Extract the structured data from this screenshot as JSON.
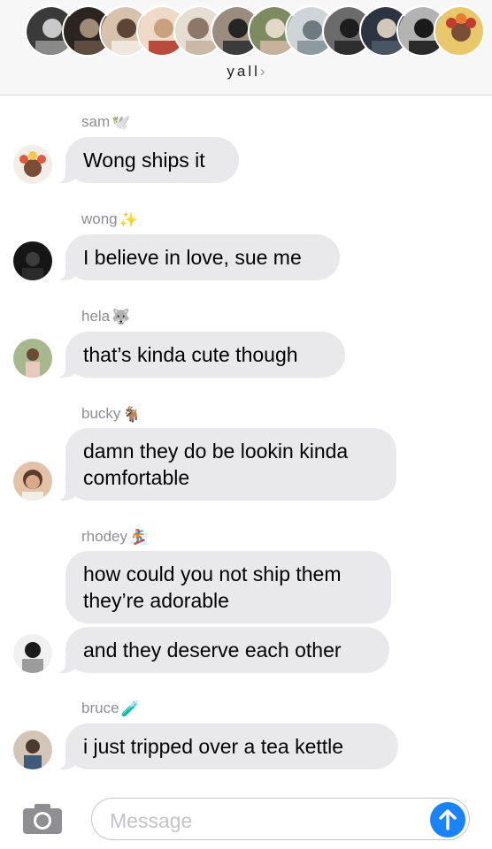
{
  "header": {
    "group_name": "yall",
    "avatars": [
      {
        "name": "member-1",
        "colors": [
          "#3a3a3a",
          "#c9c9c9"
        ]
      },
      {
        "name": "member-2",
        "colors": [
          "#2b2420",
          "#a08a78"
        ]
      },
      {
        "name": "member-3",
        "colors": [
          "#5a4536",
          "#d6c2ad"
        ]
      },
      {
        "name": "member-4",
        "colors": [
          "#b94a3c",
          "#efd9c7"
        ]
      },
      {
        "name": "member-5",
        "colors": [
          "#8e7766",
          "#e6ddd3"
        ]
      },
      {
        "name": "member-6",
        "colors": [
          "#252525",
          "#9b8c80"
        ]
      },
      {
        "name": "member-7",
        "colors": [
          "#7c8c60",
          "#e2d8c6"
        ]
      },
      {
        "name": "member-8",
        "colors": [
          "#6e7a80",
          "#cfd4d6"
        ]
      },
      {
        "name": "member-9",
        "colors": [
          "#1d1d1d",
          "#6b6b6b"
        ]
      },
      {
        "name": "member-10",
        "colors": [
          "#2b3440",
          "#d2c7bb"
        ]
      },
      {
        "name": "member-11",
        "colors": [
          "#1a1a1a",
          "#b3b3b3"
        ]
      },
      {
        "name": "member-12",
        "colors": [
          "#c23b2e",
          "#e9c86b"
        ]
      }
    ]
  },
  "messages": [
    {
      "sender": "sam",
      "emoji": "🕊️",
      "text": "Wong ships it",
      "avatar": [
        "#e0593f",
        "#f6c84c"
      ]
    },
    {
      "sender": "wong",
      "emoji": "✨",
      "text": "I believe in love, sue me",
      "avatar": [
        "#151515",
        "#3c3c3c"
      ]
    },
    {
      "sender": "hela",
      "emoji": "🐺",
      "text": "that’s kinda cute though",
      "avatar": [
        "#a7b78e",
        "#e8c9c0"
      ]
    },
    {
      "sender": "bucky",
      "emoji": "🐐",
      "text_line1": "damn they do be lookin kinda",
      "text_line2": "comfortable",
      "avatar": [
        "#5c3b2e",
        "#e3c3a7"
      ]
    },
    {
      "sender": "rhodey",
      "emoji": "🏂",
      "text_line1": "how could you not ship them",
      "text_line2": "they’re adorable",
      "text_extra": "and they deserve each other",
      "avatar": [
        "#1b1b1b",
        "#9c9c9c"
      ]
    },
    {
      "sender": "bruce",
      "emoji": "🧪",
      "text": "i just tripped over a tea kettle",
      "avatar": [
        "#3f5a7a",
        "#d3c6b6"
      ]
    }
  ],
  "input": {
    "placeholder": "Message"
  },
  "colors": {
    "bubble": "#e9e9eb",
    "send_button": "#1a82fb",
    "sender_name": "#8e8e93"
  },
  "icons": {
    "camera": "camera-icon",
    "send": "arrow-up-icon"
  }
}
